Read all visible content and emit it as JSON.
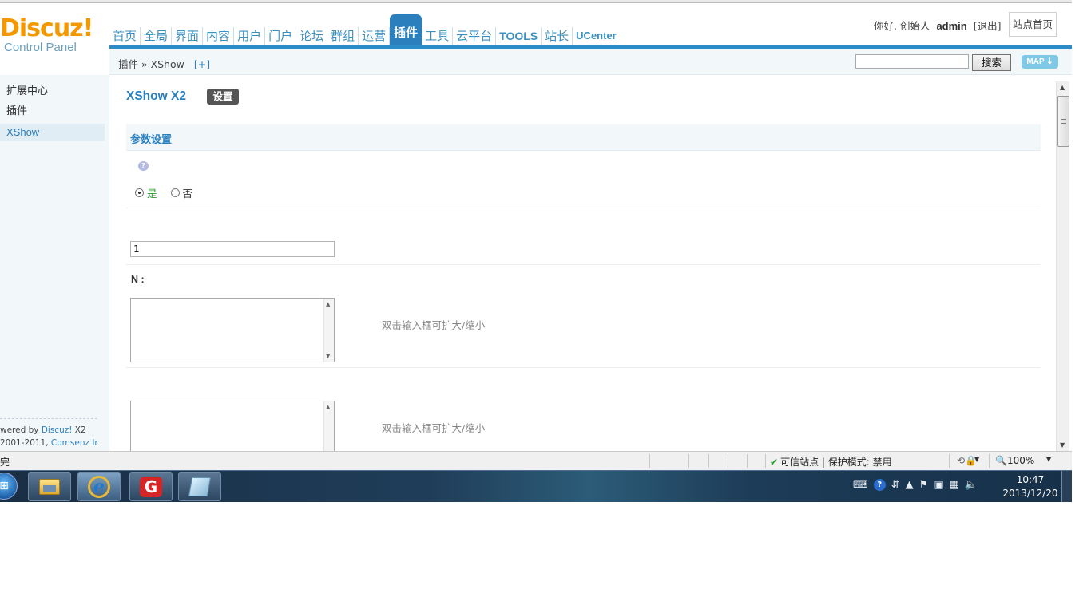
{
  "header": {
    "logo_title": "Discuz!",
    "logo_sub": "Control Panel",
    "nav": [
      "首页",
      "全局",
      "界面",
      "内容",
      "用户",
      "门户",
      "论坛",
      "群组",
      "运营",
      "插件",
      "工具",
      "云平台",
      "TOOLS",
      "站长",
      "UCenter"
    ],
    "active_nav": "插件",
    "greeting": "你好, 创始人",
    "username": "admin",
    "logout": "[退出]",
    "home_button": "站点首页"
  },
  "subheader": {
    "breadcrumb": "插件 » XShow",
    "add": "[+]",
    "search_value": "",
    "search_button": "搜索",
    "map_button": "MAP ⇣"
  },
  "sidebar": {
    "items": [
      "扩展中心",
      "插件",
      "XShow"
    ],
    "active": "XShow",
    "footer_line1_prefix": "wered by ",
    "footer_line1_link": "Discuz!",
    "footer_line1_suffix": " X2",
    "footer_line2_prefix": "2001-2011, ",
    "footer_line2_link": "Comsenz Inc."
  },
  "main": {
    "title": "XShow X2",
    "settings_button": "设置",
    "section_title": "参数设置",
    "help_icon_glyph": "?",
    "radio_yes": "是",
    "radio_no": "否",
    "radio_selected": "是",
    "text_input_value": "1",
    "field_label": "N :",
    "textarea1_tip": "双击输入框可扩大/缩小",
    "textarea2_tip": "双击输入框可扩大/缩小"
  },
  "statusbar": {
    "left_text": "完",
    "trusted": "可信站点 | 保护模式: 禁用",
    "zoom": "100%"
  },
  "taskbar": {
    "time": "10:47",
    "date": "2013/12/20"
  },
  "colors": {
    "accent": "#2b7fbd",
    "logo": "#f39800",
    "nav_active_bg": "#2b7fbd",
    "radio_yes": "#2b9b2b"
  }
}
